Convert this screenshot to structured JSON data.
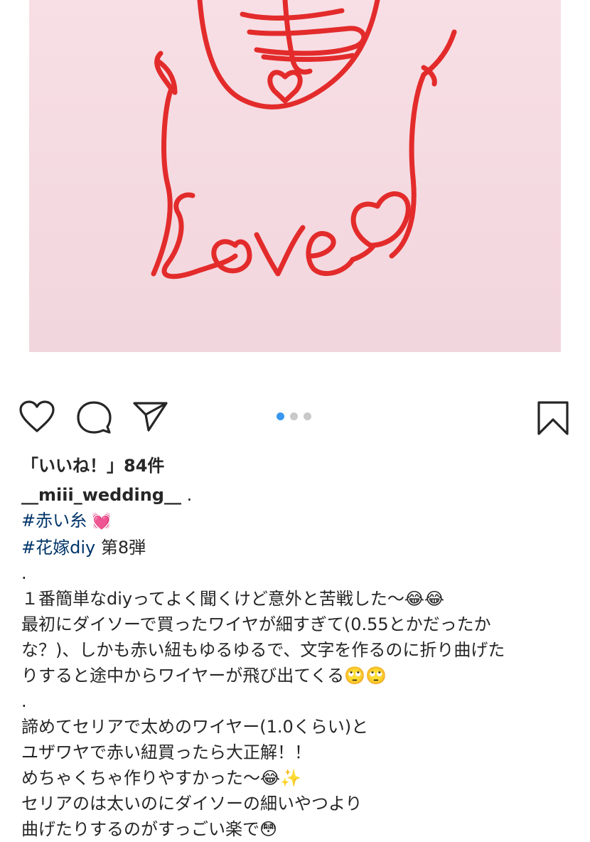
{
  "photo": {
    "wire_text_top": "寿",
    "wire_text_bottom": "Love"
  },
  "carousel": {
    "count": 3,
    "active_index": 0
  },
  "likes": {
    "text": "「いいね！」84件"
  },
  "caption": {
    "username": "__miii_wedding__",
    "username_suffix": " .",
    "tag1": "#赤い糸",
    "tag1_emoji": " 💓",
    "tag2": "#花嫁diy",
    "tag2_suffix": " 第8弾",
    "dot1": ".",
    "line1": "１番簡単なdiyってよく聞くけど意外と苦戦した〜😂😂",
    "line2": "最初にダイソーで買ったワイヤが細すぎて(0.55とかだったか",
    "line3": "な？)、しかも赤い紐もゆるゆるで、文字を作るのに折り曲げた",
    "line4": "りすると途中からワイヤーが飛び出てくる🙄🙄",
    "dot2": ".",
    "line5": "諦めてセリアで太めのワイヤー(1.0くらい)と",
    "line6": "ユザワヤで赤い紐買ったら大正解！！",
    "line7": "めちゃくちゃ作りやすかった〜😂✨",
    "line8": "セリアのは太いのにダイソーの細いやつより",
    "line9": "曲げたりするのがすっごい楽で😳"
  }
}
